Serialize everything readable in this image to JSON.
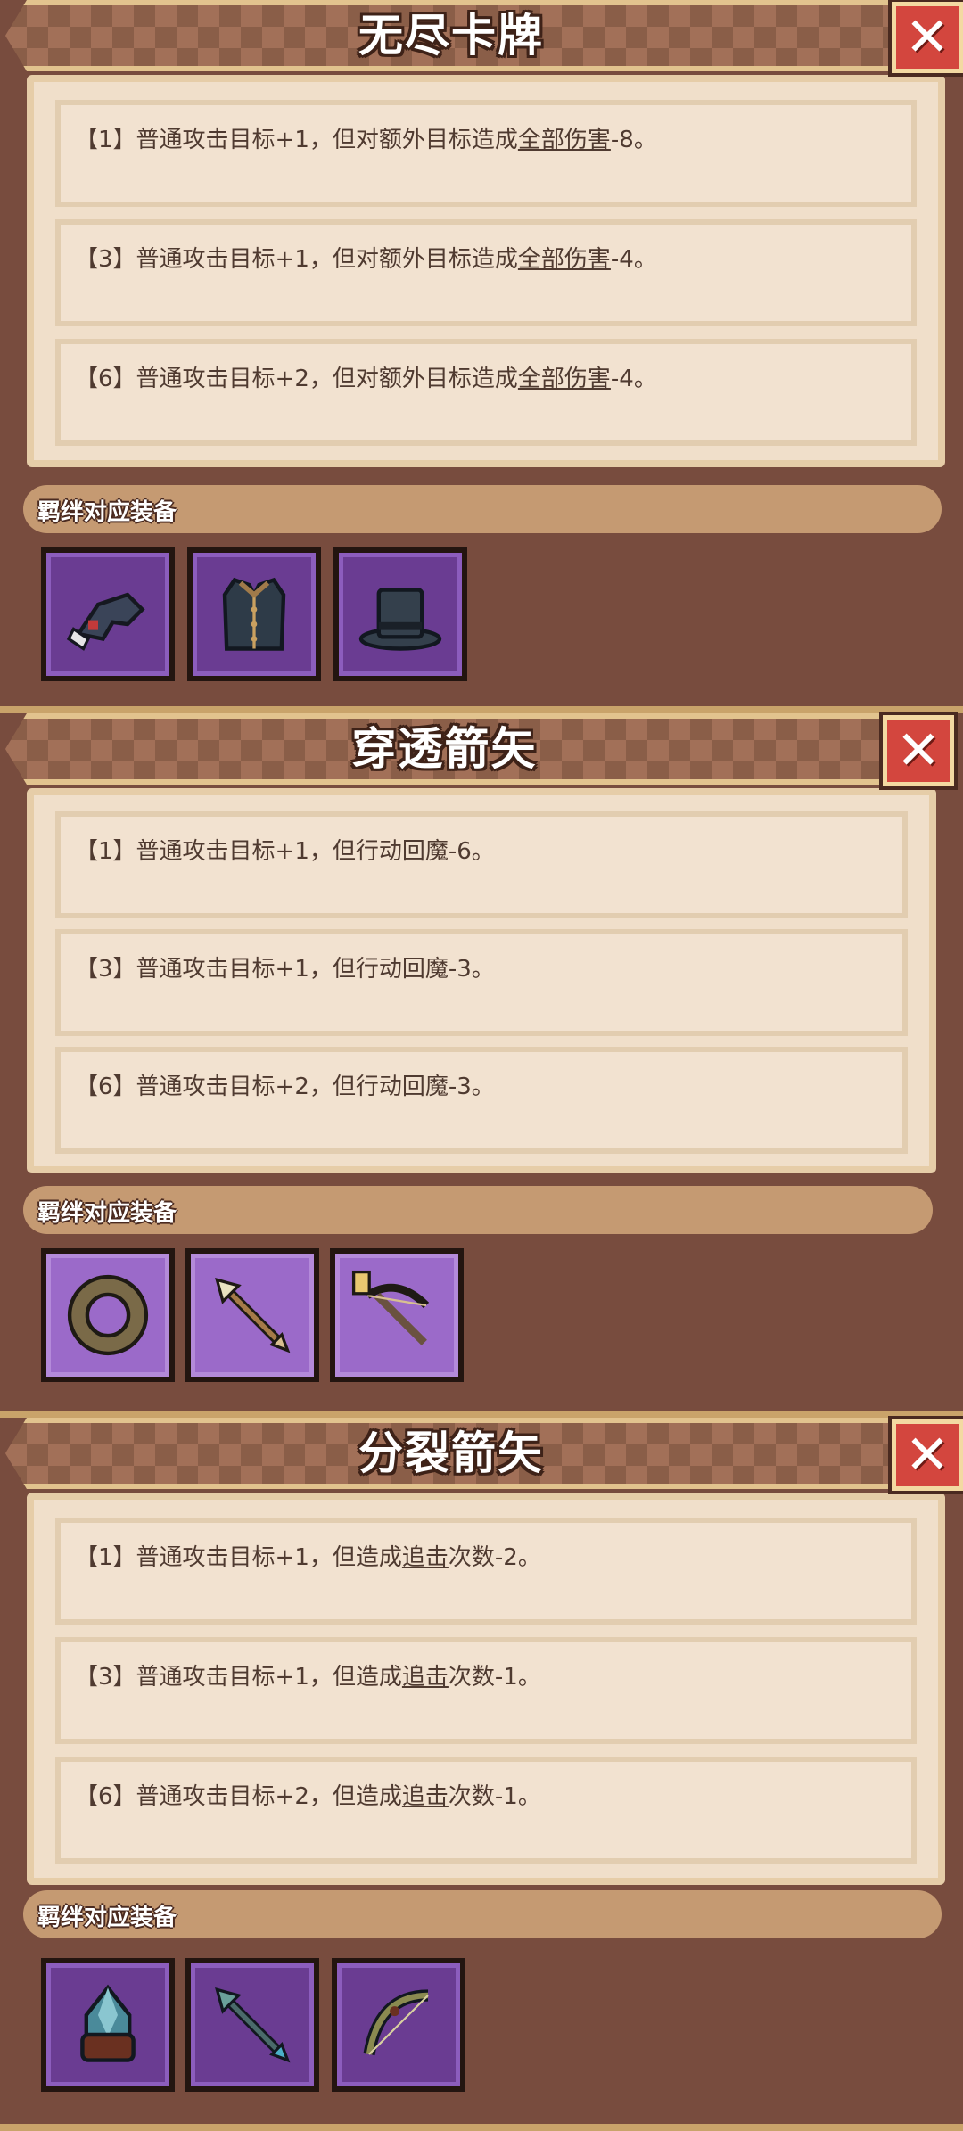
{
  "close_label": "✕",
  "sets": [
    {
      "title": "无尽卡牌",
      "effects": [
        {
          "prefix": "【1】普通攻击目标+1，但对额外目标造成",
          "link": "全部伤害",
          "suffix": "-8。"
        },
        {
          "prefix": "【3】普通攻击目标+1，但对额外目标造成",
          "link": "全部伤害",
          "suffix": "-4。"
        },
        {
          "prefix": "【6】普通攻击目标+2，但对额外目标造成",
          "link": "全部伤害",
          "suffix": "-4。"
        }
      ],
      "equip_label": "羁绊对应装备",
      "equipment": [
        "glove-icon",
        "vest-icon",
        "top-hat-icon"
      ]
    },
    {
      "title": "穿透箭矢",
      "effects": [
        {
          "prefix": "【1】普通攻击目标+1，但行动回魔-6。",
          "link": "",
          "suffix": ""
        },
        {
          "prefix": "【3】普通攻击目标+1，但行动回魔-3。",
          "link": "",
          "suffix": ""
        },
        {
          "prefix": "【6】普通攻击目标+2，但行动回魔-3。",
          "link": "",
          "suffix": ""
        }
      ],
      "equip_label": "羁绊对应装备",
      "equipment": [
        "ring-icon",
        "arrow-icon",
        "crossbow-icon"
      ]
    },
    {
      "title": "分裂箭矢",
      "effects": [
        {
          "prefix": "【1】普通攻击目标+1，但造成",
          "link": "追击",
          "suffix": "次数-2。"
        },
        {
          "prefix": "【3】普通攻击目标+1，但造成",
          "link": "追击",
          "suffix": "次数-1。"
        },
        {
          "prefix": "【6】普通攻击目标+2，但造成",
          "link": "追击",
          "suffix": "次数-1。"
        }
      ],
      "equip_label": "羁绊对应装备",
      "equipment": [
        "helmet-icon",
        "arrow-icon",
        "bow-icon"
      ]
    }
  ]
}
